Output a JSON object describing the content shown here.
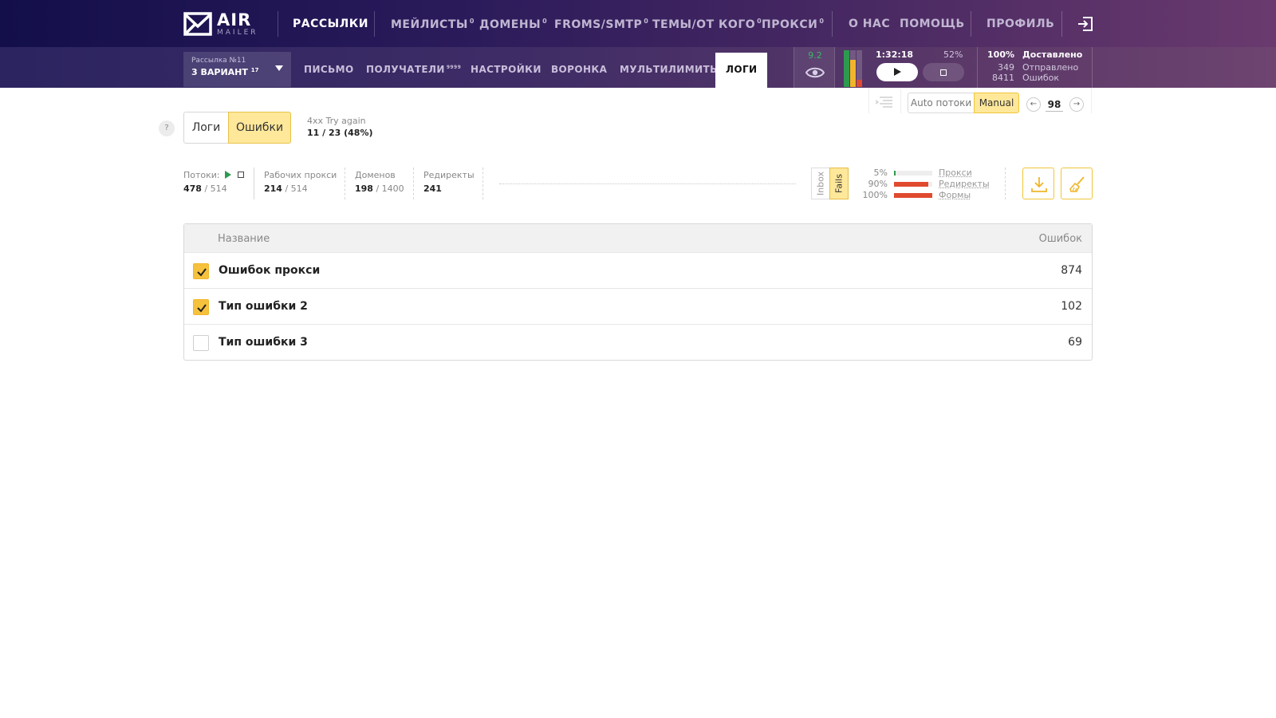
{
  "brand": {
    "name": "AIR",
    "sub": "MAILER"
  },
  "topnav": {
    "items": [
      {
        "label": "РАССЫЛКИ",
        "sup": ""
      },
      {
        "label": "МЕЙЛИСТЫ",
        "sup": "0"
      },
      {
        "label": "ДОМЕНЫ",
        "sup": "0"
      },
      {
        "label": "FROMS/SMTP",
        "sup": "0"
      },
      {
        "label": "ТЕМЫ/ОТ КОГО",
        "sup": "0"
      },
      {
        "label": "ПРОКСИ",
        "sup": "0"
      },
      {
        "label": "О НАС",
        "sup": ""
      },
      {
        "label": "ПОМОЩЬ",
        "sup": ""
      },
      {
        "label": "ПРОФИЛЬ",
        "sup": ""
      }
    ],
    "logout_icon": "logout-icon"
  },
  "campaign": {
    "number_label": "Рассылка №11",
    "name": "3 ВАРИАНТ",
    "sup": "17"
  },
  "subtabs": [
    {
      "label": "ПИСЬМО",
      "sup": ""
    },
    {
      "label": "ПОЛУЧАТЕЛИ",
      "sup": "9999"
    },
    {
      "label": "НАСТРОЙКИ",
      "sup": ""
    },
    {
      "label": "ВОРОНКА",
      "sup": ""
    },
    {
      "label": "МУЛЬТИЛИМИТЫ",
      "sup": ""
    },
    {
      "label": "ЛОГИ",
      "sup": ""
    }
  ],
  "score": "9.2",
  "timer": "1:32:18",
  "progress": "52%",
  "summary": [
    {
      "num": "100%",
      "label": "Доставлено"
    },
    {
      "num": "349",
      "label": "Отправлено"
    },
    {
      "num": "8411",
      "label": "Ошибок"
    }
  ],
  "threads": {
    "auto_label": "Auto потоки",
    "manual_label": "Manual",
    "value": "98"
  },
  "help": "?",
  "toggles": {
    "logs": "Логи",
    "errors": "Ошибки"
  },
  "retry": {
    "label": "4xx Try again",
    "value": "11 / 23 (48%)"
  },
  "metrics": [
    {
      "label": "Потоки:",
      "value": "478",
      "total": "/ 514"
    },
    {
      "label": "Рабочих прокси",
      "value": "214",
      "total": "/ 514"
    },
    {
      "label": "Доменов",
      "value": "198",
      "total": "/ 1400"
    },
    {
      "label": "Редиректы",
      "value": "241",
      "total": ""
    }
  ],
  "vtabs": {
    "inbox": "Inbox",
    "fails": "Fails"
  },
  "rates": [
    {
      "pct": "5%",
      "label": "Прокси",
      "fill": 0.05,
      "color": "#2e9a4f"
    },
    {
      "pct": "90%",
      "label": "Редиректы",
      "fill": 0.9,
      "color": "#e04a2f"
    },
    {
      "pct": "100%",
      "label": "Формы",
      "fill": 1.0,
      "color": "#e04a2f"
    }
  ],
  "table": {
    "col_name": "Название",
    "col_count": "Ошибок",
    "rows": [
      {
        "name": "Ошибок прокси",
        "count": "874",
        "checked": true
      },
      {
        "name": "Тип ошибки 2",
        "count": "102",
        "checked": true
      },
      {
        "name": "Тип ошибки 3",
        "count": "69",
        "checked": false
      }
    ]
  },
  "colors": {
    "accent": "#f6c23e",
    "accent_bg": "#ffe89a",
    "green": "#2e9a4f",
    "red": "#e04a2f",
    "nav_dark": "#130f4a"
  }
}
